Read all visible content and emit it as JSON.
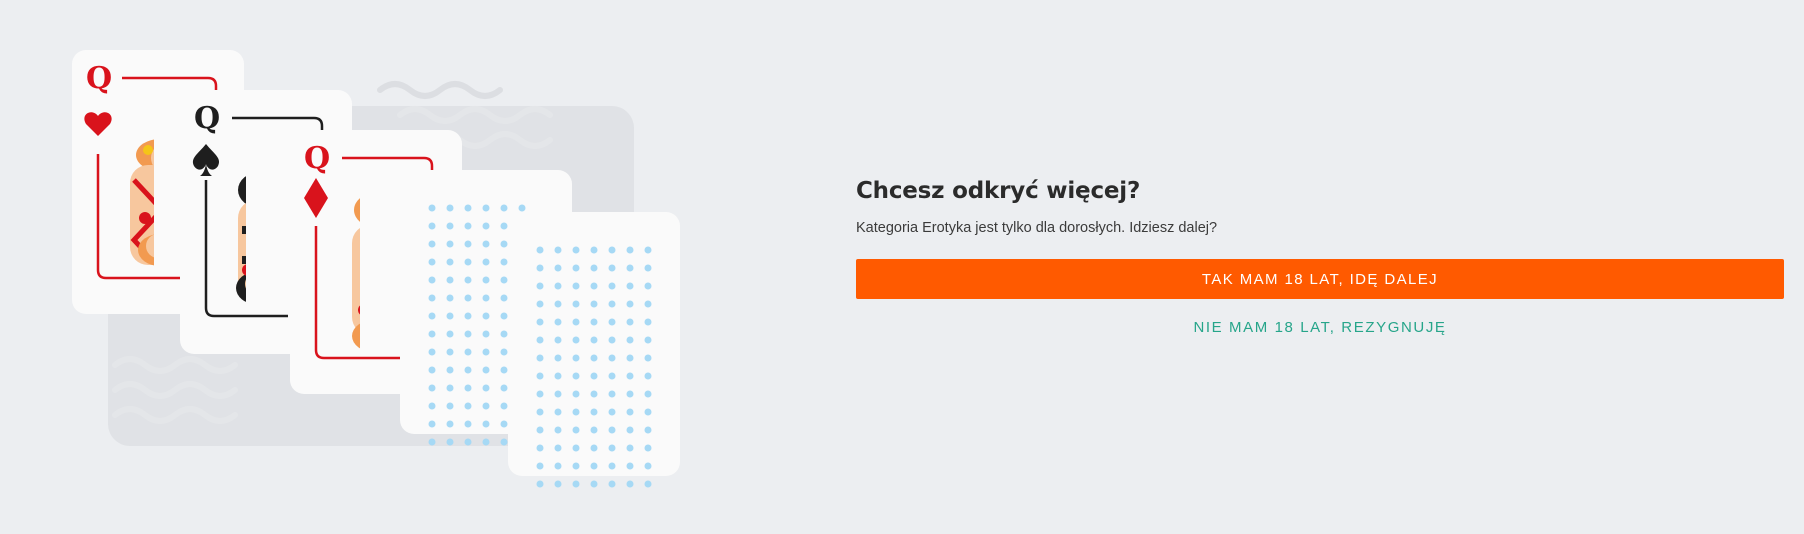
{
  "modal": {
    "title": "Chcesz odkryć więcej?",
    "description": "Kategoria Erotyka jest tylko dla dorosłych. Idziesz dalej?",
    "accept_label": "TAK MAM 18 LAT, IDĘ DALEJ",
    "decline_label": "NIE MAM 18 LAT, REZYGNUJĘ"
  },
  "cards": [
    {
      "rank": "Q",
      "suit": "heart-icon",
      "color": "#d9131c"
    },
    {
      "rank": "Q",
      "suit": "spade-icon",
      "color": "#1e1e1e"
    },
    {
      "rank": "Q",
      "suit": "diamond-icon",
      "color": "#d9131c"
    }
  ],
  "colors": {
    "accent": "#ff5a00",
    "decline": "#26a58a",
    "red_suit": "#d9131c",
    "black_suit": "#1e1e1e",
    "card_back_dots": "#a6d9f5",
    "background": "#eceef1"
  }
}
